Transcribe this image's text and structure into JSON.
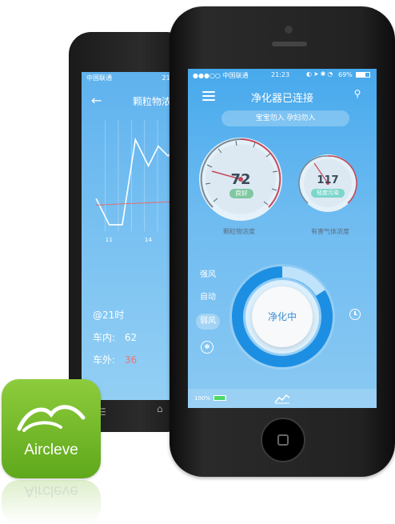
{
  "back_screen": {
    "status": "中国联通",
    "time": "21",
    "title": "颗粒物浓",
    "x_ticks": [
      "11",
      "14"
    ],
    "time_label": "@21时",
    "inside_label": "车内:",
    "inside_value": "62",
    "outside_label": "车外:",
    "outside_value": "36"
  },
  "front_screen": {
    "status": {
      "carrier": "●●●○○ 中国联通",
      "time": "21:23",
      "battery": "69%"
    },
    "header_title": "净化器已连接",
    "notice": "宝宝勿入 孕妇勿入",
    "gauge_pm": {
      "value": "72",
      "quality": "良好",
      "caption": "颗粒物浓度",
      "ticks": [
        "30",
        "60",
        "90",
        "120",
        "150",
        "180",
        "210",
        "240",
        "270",
        "300"
      ]
    },
    "gauge_gas": {
      "value": "117",
      "quality": "轻度污染",
      "caption": "有害气体浓度"
    },
    "modes": [
      "强风",
      "自动",
      "弱风"
    ],
    "selected_mode": "弱风",
    "center_button": "净化中",
    "bottom_battery": "100%"
  },
  "app_icon": {
    "name": "Aircleve"
  }
}
